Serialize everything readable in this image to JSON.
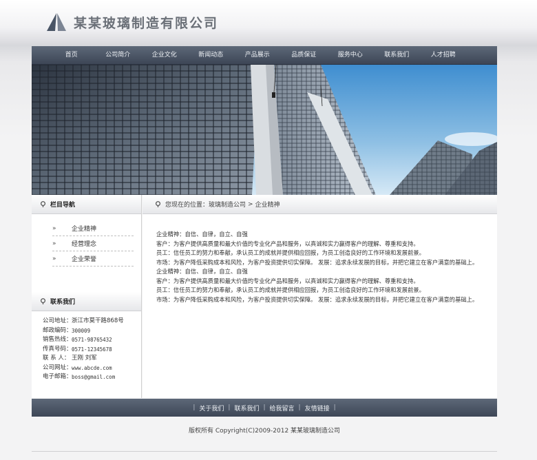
{
  "header": {
    "company_name": "某某玻璃制造有限公司"
  },
  "nav": {
    "items": [
      "首页",
      "公司简介",
      "企业文化",
      "新闻动态",
      "产品展示",
      "品质保证",
      "服务中心",
      "联系我们",
      "人才招聘"
    ]
  },
  "sidebar": {
    "title": "栏目导航",
    "arrow": "»",
    "items": [
      "企业精神",
      "经营理念",
      "企业荣誉"
    ]
  },
  "contact": {
    "title": "联系我们",
    "rows": [
      {
        "k": "公司地址：",
        "v": "浙江市莫干路868号"
      },
      {
        "k": "邮政编码：",
        "v": "300009"
      },
      {
        "k": "销售热线：",
        "v": "0571-98765432"
      },
      {
        "k": "传真号码：",
        "v": "0571-12345678"
      },
      {
        "k": "联 系 人：",
        "v": "王刚 刘军"
      },
      {
        "k": "公司网址：",
        "v": "www.abcde.com"
      },
      {
        "k": "电子邮箱：",
        "v": "boss@gmail.com"
      }
    ]
  },
  "breadcrumb": {
    "prefix": "您现在的位置：",
    "home": "玻璃制造公司",
    "sep": ">",
    "current": "企业精神"
  },
  "content": {
    "lines": [
      "企业精神：自信、自律，自立、自强",
      "客户：为客户提供高质量和最大价值的专业化产品和服务，以真诚和实力赢得客户的理解、尊重和支持。",
      "员工：信任员工的努力和奉献，承认员工的成就并提供相应回报，为员工创造良好的工作环境和发展前景。",
      "市场：为客户降低采购成本和风险，为客户投资提供切实保障。 发展：追求永续发展的目标，并把它建立在客户满意的基础上。",
      "企业精神：自信、自律，自立、自强",
      "客户：为客户提供高质量和最大价值的专业化产品和服务，以真诚和实力赢得客户的理解、尊重和支持。",
      "员工：信任员工的努力和奉献，承认员工的成就并提供相应回报，为员工创造良好的工作环境和发展前景。",
      "市场：为客户降低采购成本和风险，为客户投资提供切实保障。 发展：追求永续发展的目标，并把它建立在客户满意的基础上。"
    ]
  },
  "footer": {
    "links": [
      "关于我们",
      "联系我们",
      "给我留言",
      "友情链接"
    ],
    "pipe": "|",
    "copyright": "版权所有 Copyright(C)2009-2012 某某玻璃制造公司"
  },
  "colors": {
    "nav_top": "#5d6878",
    "nav_bottom": "#3d4656",
    "sky": "#7fb2da"
  }
}
